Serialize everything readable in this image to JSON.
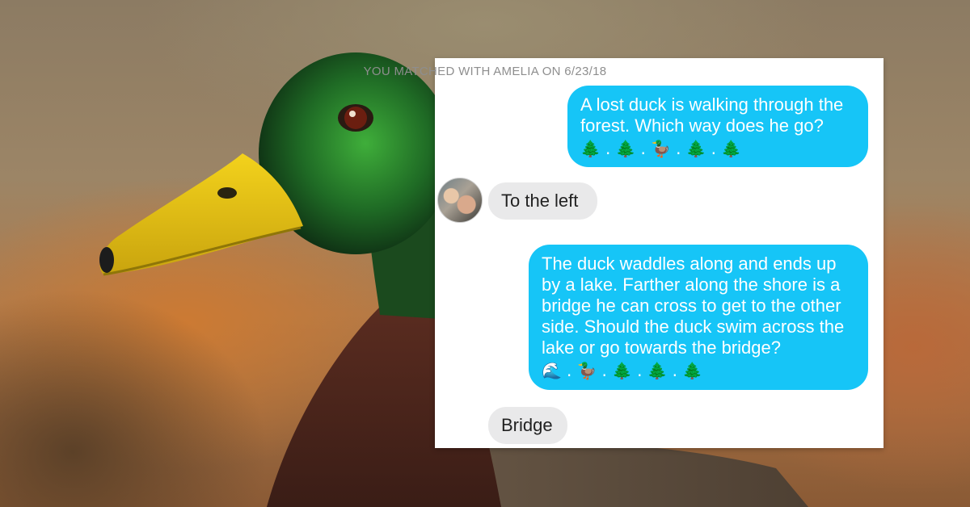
{
  "match_header": "YOU MATCHED WITH AMELIA ON 6/23/18",
  "messages": [
    {
      "type": "sent",
      "text": "A lost duck is walking through the forest. Which way does he go?",
      "emoji": [
        "🌲",
        ".",
        "🌲",
        ".",
        "🦆",
        ".",
        "🌲",
        ".",
        "🌲"
      ]
    },
    {
      "type": "received",
      "text": "To the left"
    },
    {
      "type": "sent",
      "text": "The duck waddles along and ends up by a lake. Farther along the shore is a bridge he can cross to get to the other side. Should the duck swim across the lake or go towards the bridge?",
      "emoji": [
        "🌊",
        ".",
        "🦆",
        ".",
        "🌲",
        ".",
        "🌲",
        ".",
        "🌲"
      ]
    },
    {
      "type": "received",
      "text": "Bridge"
    }
  ],
  "colors": {
    "sent_bubble": "#16c5f7",
    "received_bubble": "#e9e9ea",
    "header_text": "#8e8e8e"
  }
}
